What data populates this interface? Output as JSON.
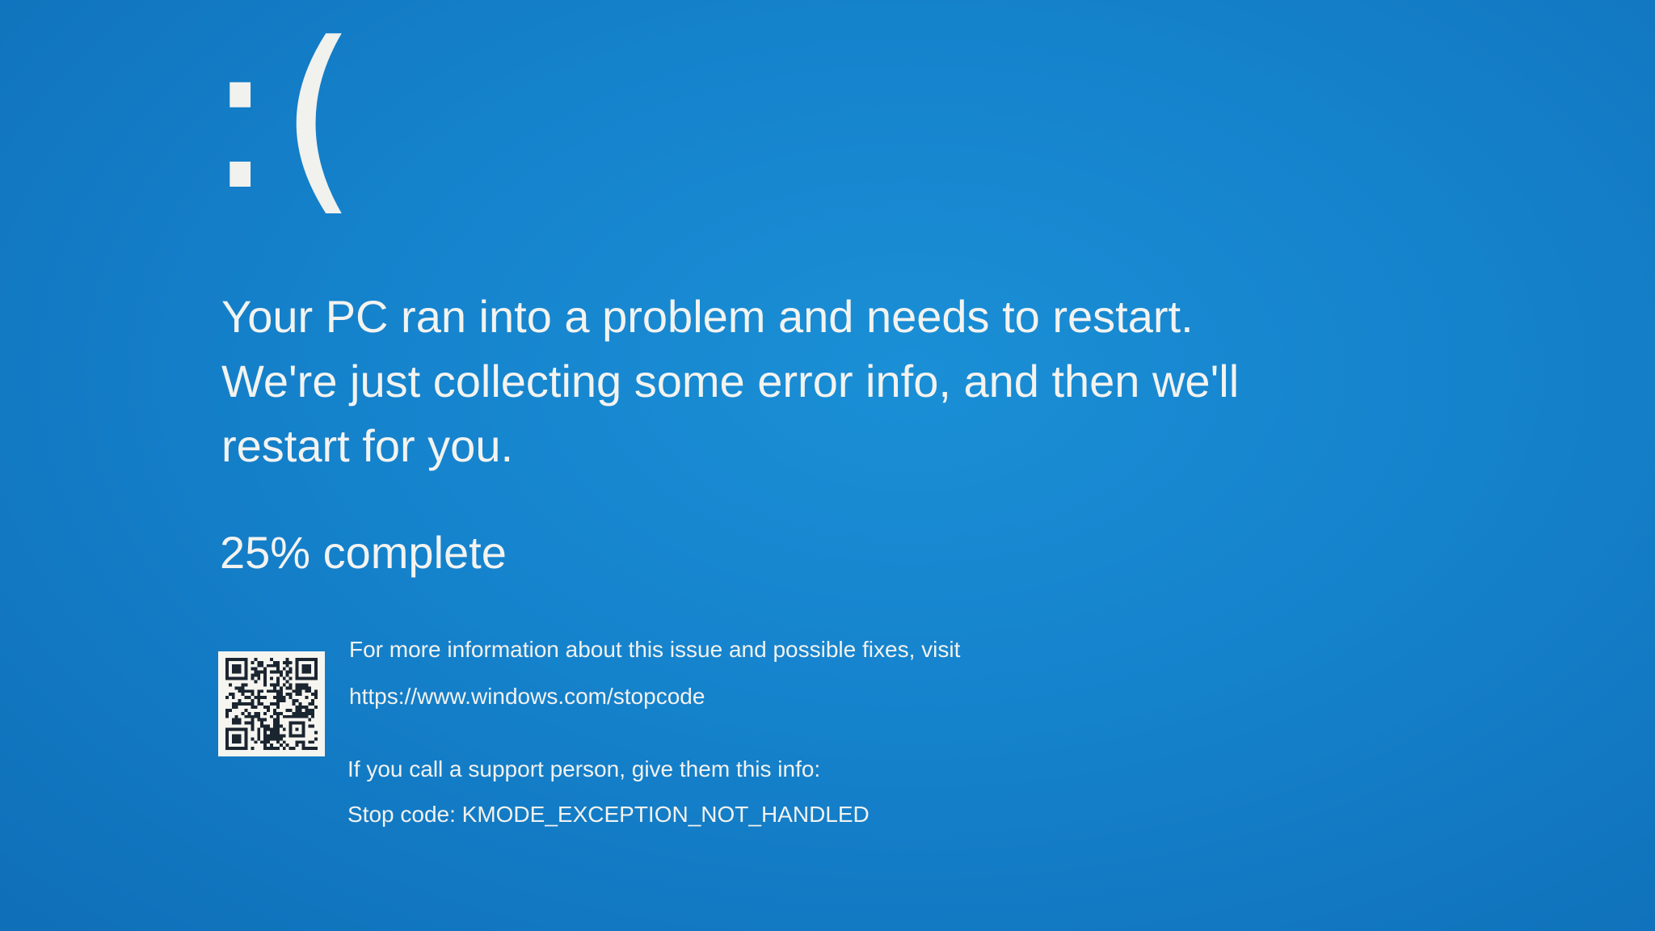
{
  "frown": ":(",
  "message": "Your PC ran into a problem and needs to restart. We're just collecting some error info, and then we'll restart for you.",
  "progress": {
    "percent": 25,
    "text": "25% complete"
  },
  "info": {
    "fixes_text": "For more information about this issue and possible fixes, visit",
    "url": "https://www.windows.com/stopcode",
    "support_text": "If you call a support person, give them this info:",
    "stop_code_label": "Stop code:",
    "stop_code": "KMODE_EXCEPTION_NOT_HANDLED"
  },
  "colors": {
    "background": "#1582cc",
    "text": "#f3f3f0"
  },
  "icons": {
    "qr": "qr-code-icon"
  }
}
